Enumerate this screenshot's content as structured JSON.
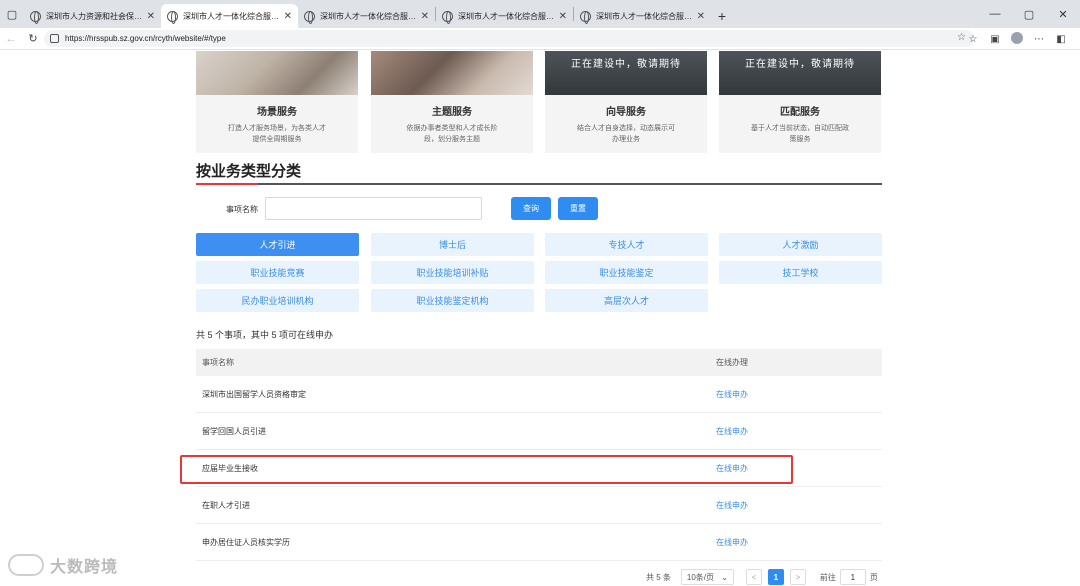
{
  "browser": {
    "tabs": [
      {
        "title": "深圳市人力资源和社会保障局网站",
        "active": false
      },
      {
        "title": "深圳市人才一体化综合服务平台",
        "active": true
      },
      {
        "title": "深圳市人才一体化综合服务平台",
        "active": false
      },
      {
        "title": "深圳市人才一体化综合服务平台",
        "active": false
      },
      {
        "title": "深圳市人才一体化综合服务平台",
        "active": false
      }
    ],
    "url": "https://hrsspub.sz.gov.cn/rcyth/website/#/type",
    "icons": {
      "back": "back-arrow-icon",
      "refresh": "refresh-icon",
      "star": "star-icon"
    }
  },
  "cards": [
    {
      "title": "场景服务",
      "desc": "打造人才服务场景，为各类人才提供全周期服务",
      "img_text": ""
    },
    {
      "title": "主题服务",
      "desc": "依据办事者类型和人才成长阶段，划分服务主题",
      "img_text": ""
    },
    {
      "title": "向导服务",
      "desc": "结合人才自身选择，动态展示可办理业务",
      "img_text": "正在建设中，敬请期待"
    },
    {
      "title": "匹配服务",
      "desc": "基于人才当前状态，自动匹配政策服务",
      "img_text": "正在建设中，敬请期待"
    }
  ],
  "section": {
    "title": "按业务类型分类",
    "search_label": "事项名称",
    "search_placeholder": "",
    "query_button": "查询",
    "reset_button": "重置"
  },
  "categories": [
    {
      "label": "人才引进",
      "active": true
    },
    {
      "label": "博士后",
      "active": false
    },
    {
      "label": "专技人才",
      "active": false
    },
    {
      "label": "人才激励",
      "active": false
    },
    {
      "label": "职业技能竞赛",
      "active": false
    },
    {
      "label": "职业技能培训补贴",
      "active": false
    },
    {
      "label": "职业技能鉴定",
      "active": false
    },
    {
      "label": "技工学校",
      "active": false
    },
    {
      "label": "民办职业培训机构",
      "active": false
    },
    {
      "label": "职业技能鉴定机构",
      "active": false
    },
    {
      "label": "高层次人才",
      "active": false
    }
  ],
  "summary": "共 5 个事项，其中 5 项可在线申办",
  "table": {
    "headers": {
      "name": "事项名称",
      "op": "在线办理"
    },
    "rows": [
      {
        "name": "深圳市出国留学人员资格审定",
        "op": "在线申办"
      },
      {
        "name": "留学回国人员引进",
        "op": "在线申办"
      },
      {
        "name": "应届毕业生接收",
        "op": "在线申办"
      },
      {
        "name": "在职人才引进",
        "op": "在线申办"
      },
      {
        "name": "申办居住证人员核实学历",
        "op": "在线申办"
      }
    ]
  },
  "pagination": {
    "total": "共 5 条",
    "page_size": "10条/页",
    "prev": "<",
    "current": "1",
    "next": ">",
    "goto_label": "前往",
    "goto_value": "1",
    "page_unit": "页"
  },
  "watermark": "大数跨境",
  "colors": {
    "accent": "#2f8cf0",
    "highlight": "#e53935",
    "title_underline": "#e8363e"
  }
}
